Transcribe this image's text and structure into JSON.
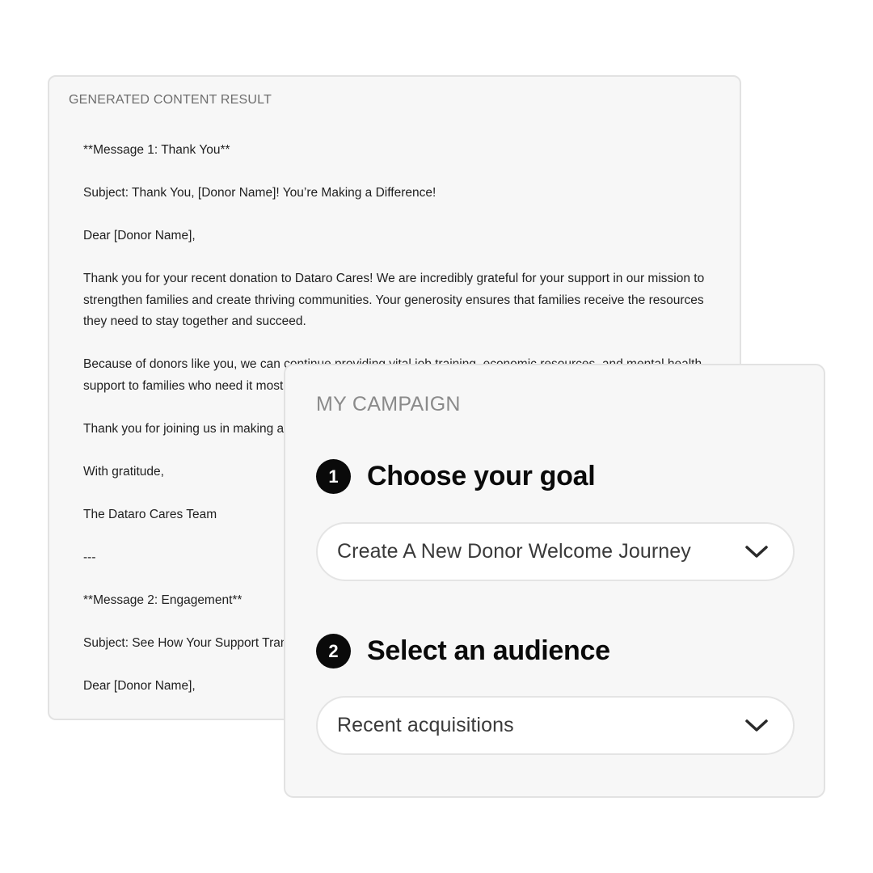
{
  "result": {
    "heading": "GENERATED CONTENT RESULT",
    "lines": [
      "**Message 1: Thank You**",
      "",
      "Subject: Thank You, [Donor Name]! You’re Making a Difference!",
      "",
      "Dear [Donor Name],",
      "",
      "Thank you for your recent donation to Dataro Cares! We are incredibly grateful for your support in our mission to",
      "strengthen families and create thriving communities. Your generosity ensures that families receive the resources",
      "they need to stay together and succeed.",
      "",
      "Because of donors like you, we can continue providing vital job training, economic resources, and mental health",
      "support to families who need it most.",
      "",
      "Thank you for joining us in making a",
      "",
      "With gratitude,",
      "",
      "The Dataro Cares Team",
      "",
      "---",
      "",
      "**Message 2: Engagement**",
      "",
      "Subject: See How Your Support Transforms",
      "",
      "Dear [Donor Name],"
    ]
  },
  "campaign": {
    "heading": "MY CAMPAIGN",
    "steps": [
      {
        "number": "1",
        "title": "Choose your goal",
        "selected": "Create A New Donor Welcome Journey"
      },
      {
        "number": "2",
        "title": "Select an audience",
        "selected": "Recent acquisitions"
      }
    ]
  },
  "colors": {
    "card_background": "#f7f7f7",
    "card_border": "#e2e2e2",
    "step_badge": "#0a0a0a",
    "heading_grey": "#8a8a8a"
  },
  "icons": {
    "dropdown": "chevron-down-icon"
  }
}
